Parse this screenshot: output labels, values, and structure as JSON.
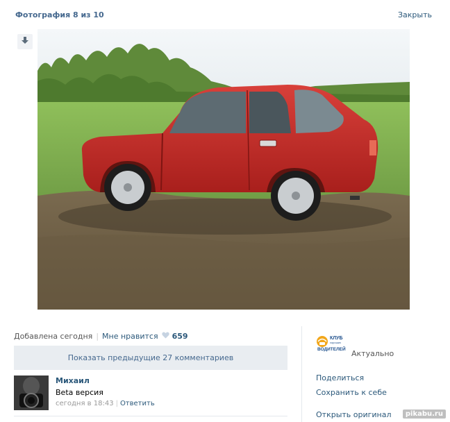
{
  "header": {
    "title": "Фотография 8 из 10",
    "close_label": "Закрыть"
  },
  "photo": {
    "description_icon": "download-icon"
  },
  "meta": {
    "added": "Добавлена сегодня",
    "like_label": "Мне нравится",
    "likes_count": "659"
  },
  "comments": {
    "show_previous": "Показать предыдущие 27 комментариев",
    "items": [
      {
        "author": "Михаил",
        "text": "Beta версия",
        "time": "сегодня в 18:43",
        "reply_label": "Ответить"
      }
    ]
  },
  "owner": {
    "logo_line1": "КЛУБ",
    "logo_line2": "хороших",
    "logo_line3": "ВОДИТЕЛЕЙ",
    "status": "Актуально"
  },
  "actions": {
    "share": "Поделиться",
    "save": "Сохранить к себе",
    "open_original": "Открыть оригинал"
  },
  "watermark": "pikabu.ru",
  "colors": {
    "link": "#2b587a",
    "title": "#45688e",
    "panel": "#e9edf1",
    "car": "#c62828"
  }
}
